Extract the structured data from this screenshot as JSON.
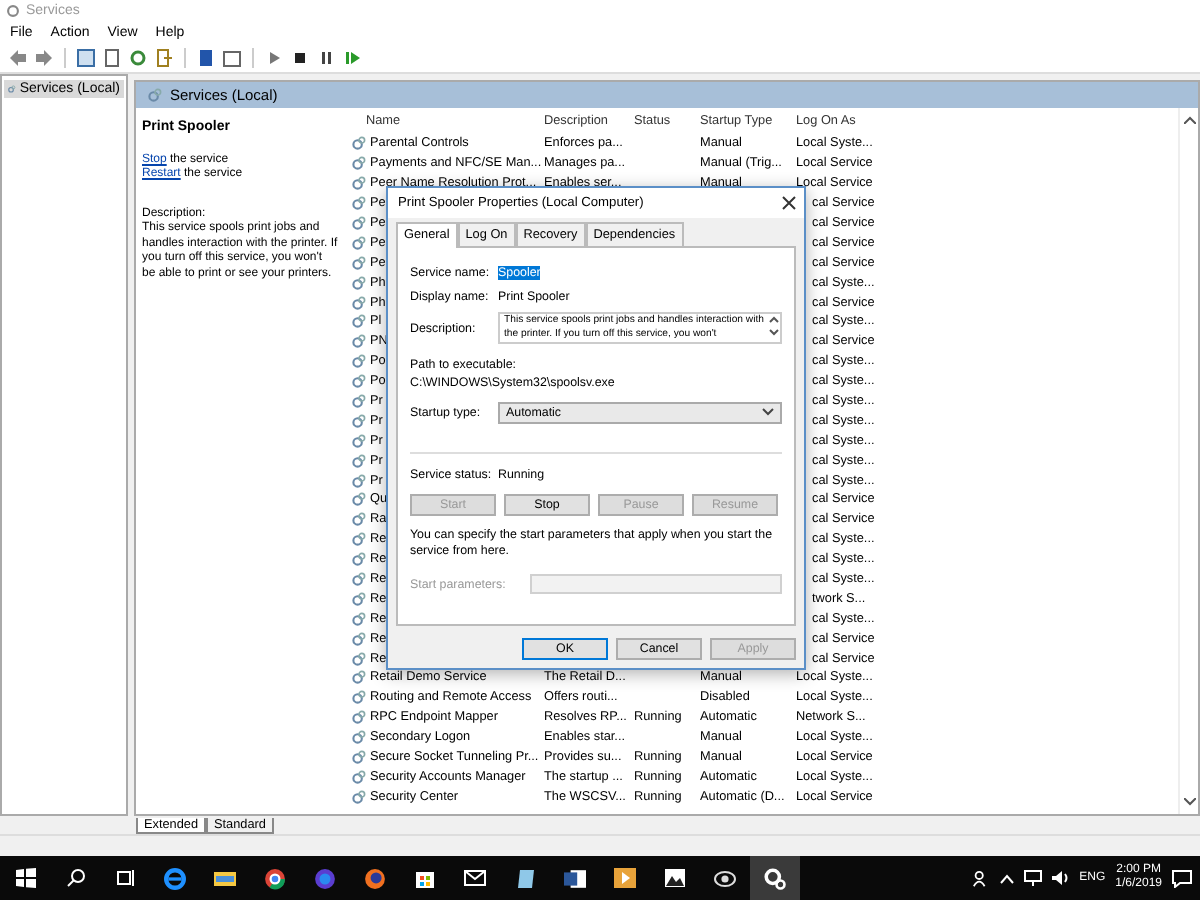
{
  "window": {
    "title": "Services"
  },
  "menu": [
    "File",
    "Action",
    "View",
    "Help"
  ],
  "tree": {
    "items": [
      {
        "label": "Services (Local)",
        "selected": true
      }
    ]
  },
  "panel": {
    "title": "Services (Local)"
  },
  "detail": {
    "heading": "Print Spooler",
    "actions": [
      {
        "link": "Stop",
        "text": "the service"
      },
      {
        "link": "Restart",
        "text": "the service"
      }
    ],
    "description_label": "Description:",
    "description": "This service spools print jobs and handles interaction with the printer. If you turn off this service, you won't be able to print or see your printers."
  },
  "list": {
    "columns": [
      "Name",
      "Description",
      "Status",
      "Startup Type",
      "Log On As"
    ],
    "rows": [
      {
        "kind": "full",
        "name": "Parental Controls",
        "description": "Enforces pa...",
        "startup": "Manual",
        "log_on": "Local Syste..."
      },
      {
        "kind": "full",
        "name": "Payments and NFC/SE Man...",
        "description": "Manages pa...",
        "startup": "Manual (Trig...",
        "log_on": "Local Service"
      },
      {
        "kind": "full",
        "name": "Peer Name Resolution Prot...",
        "description": "Enables ser...",
        "startup": "Manual",
        "log_on": "Local Service"
      },
      {
        "kind": "covered",
        "name": "Pe",
        "log_on": "cal Service"
      },
      {
        "kind": "covered",
        "name": "Pe",
        "log_on": "cal Service"
      },
      {
        "kind": "covered",
        "name": "Pe",
        "log_on": "cal Service"
      },
      {
        "kind": "covered",
        "name": "Pe",
        "log_on": "cal Service"
      },
      {
        "kind": "covered",
        "name": "Ph",
        "log_on": "cal Syste..."
      },
      {
        "kind": "covered",
        "name": "Ph",
        "log_on": "cal Service"
      },
      {
        "kind": "covered",
        "name": "Pl",
        "log_on": "cal Syste..."
      },
      {
        "kind": "covered",
        "name": "PN",
        "log_on": "cal Service"
      },
      {
        "kind": "covered",
        "name": "Po",
        "log_on": "cal Syste..."
      },
      {
        "kind": "covered",
        "name": "Po",
        "log_on": "cal Syste..."
      },
      {
        "kind": "covered",
        "name": "Pr",
        "log_on": "cal Syste..."
      },
      {
        "kind": "covered",
        "name": "Pr",
        "log_on": "cal Syste..."
      },
      {
        "kind": "covered",
        "name": "Pr",
        "log_on": "cal Syste..."
      },
      {
        "kind": "covered",
        "name": "Pr",
        "log_on": "cal Syste..."
      },
      {
        "kind": "covered",
        "name": "Pr",
        "log_on": "cal Syste..."
      },
      {
        "kind": "covered",
        "name": "Qu",
        "log_on": "cal Service"
      },
      {
        "kind": "covered",
        "name": "Ra",
        "log_on": "cal Service"
      },
      {
        "kind": "covered",
        "name": "Re",
        "log_on": "cal Syste..."
      },
      {
        "kind": "covered",
        "name": "Re",
        "log_on": "cal Syste..."
      },
      {
        "kind": "covered",
        "name": "Re",
        "log_on": "cal Syste..."
      },
      {
        "kind": "covered",
        "name": "Re",
        "log_on": "twork S..."
      },
      {
        "kind": "covered",
        "name": "Re",
        "log_on": "cal Syste..."
      },
      {
        "kind": "covered",
        "name": "Re",
        "log_on": "cal Service"
      },
      {
        "kind": "covered",
        "name": "Re",
        "log_on": "cal Service"
      },
      {
        "kind": "full",
        "name": "Retail Demo Service",
        "description": "The Retail D...",
        "startup": "Manual",
        "log_on": "Local Syste..."
      },
      {
        "kind": "full",
        "name": "Routing and Remote Access",
        "description": "Offers routi...",
        "startup": "Disabled",
        "log_on": "Local Syste..."
      },
      {
        "kind": "full",
        "name": "RPC Endpoint Mapper",
        "description": "Resolves RP...",
        "status": "Running",
        "startup": "Automatic",
        "log_on": "Network S..."
      },
      {
        "kind": "full",
        "name": "Secondary Logon",
        "description": "Enables star...",
        "startup": "Manual",
        "log_on": "Local Syste..."
      },
      {
        "kind": "full",
        "name": "Secure Socket Tunneling Pr...",
        "description": "Provides su...",
        "status": "Running",
        "startup": "Manual",
        "log_on": "Local Service"
      },
      {
        "kind": "full",
        "name": "Security Accounts Manager",
        "description": "The startup ...",
        "status": "Running",
        "startup": "Automatic",
        "log_on": "Local Syste..."
      },
      {
        "kind": "full",
        "name": "Security Center",
        "description": "The WSCSV...",
        "status": "Running",
        "startup": "Automatic (D...",
        "log_on": "Local Service"
      }
    ]
  },
  "view_tabs": [
    {
      "label": "Extended",
      "selected": true
    },
    {
      "label": "Standard",
      "selected": false
    }
  ],
  "dialog": {
    "title": "Print Spooler Properties (Local Computer)",
    "tabs": [
      {
        "label": "General",
        "selected": true
      },
      {
        "label": "Log On",
        "selected": false
      },
      {
        "label": "Recovery",
        "selected": false
      },
      {
        "label": "Dependencies",
        "selected": false
      }
    ],
    "service_name": {
      "label": "Service name:",
      "value": "Spooler",
      "highlighted": true
    },
    "display_name": {
      "label": "Display name:",
      "value": "Print Spooler"
    },
    "description": {
      "label": "Description:",
      "value": "This service spools print jobs and handles interaction with the printer.  If you turn off this service, you won't"
    },
    "path": {
      "label": "Path to executable:",
      "value": "C:\\WINDOWS\\System32\\spoolsv.exe"
    },
    "startup_type": {
      "label": "Startup type:",
      "value": "Automatic"
    },
    "status": {
      "label": "Service status:",
      "value": "Running"
    },
    "control_buttons": [
      {
        "label": "Start",
        "disabled": true
      },
      {
        "label": "Stop",
        "disabled": false
      },
      {
        "label": "Pause",
        "disabled": true
      },
      {
        "label": "Resume",
        "disabled": true
      }
    ],
    "hint": "You can specify the start parameters that apply when you start the service from here.",
    "start_parameters": {
      "label": "Start parameters:",
      "disabled": true
    },
    "buttons": [
      {
        "label": "OK",
        "disabled": false,
        "focused": true
      },
      {
        "label": "Cancel",
        "disabled": false,
        "focused": false
      },
      {
        "label": "Apply",
        "disabled": true,
        "focused": false
      }
    ]
  },
  "taskbar": {
    "language": "ENG",
    "time": "2:00 PM",
    "date": "1/6/2019"
  }
}
